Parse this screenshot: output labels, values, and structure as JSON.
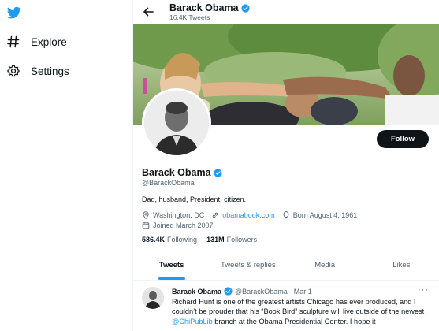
{
  "sidebar": {
    "logo": "twitter-bird-icon",
    "items": [
      {
        "label": "Explore",
        "icon": "hashtag-icon"
      },
      {
        "label": "Settings",
        "icon": "gear-icon"
      }
    ]
  },
  "header": {
    "name": "Barack Obama",
    "tweet_count": "16.4K Tweets"
  },
  "profile": {
    "name": "Barack Obama",
    "handle": "@BarackObama",
    "bio": "Dad, husband, President, citizen.",
    "location": "Washington, DC",
    "website": "obamabook.com",
    "birthday": "Born August 4, 1961",
    "joined": "Joined March 2007",
    "following_count": "586.4K",
    "following_label": "Following",
    "followers_count": "131M",
    "followers_label": "Followers",
    "follow_button": "Follow"
  },
  "tabs": [
    {
      "label": "Tweets",
      "active": true
    },
    {
      "label": "Tweets & replies",
      "active": false
    },
    {
      "label": "Media",
      "active": false
    },
    {
      "label": "Likes",
      "active": false
    }
  ],
  "tweet": {
    "name": "Barack Obama",
    "handle_date": "@BarackObama · Mar 1",
    "more": "···",
    "text_1": "Richard Hunt is one of the greatest artists Chicago has ever produced, and I couldn’t be prouder that his “Book Bird” sculpture will live outside of the newest ",
    "mention": "@ChiPubLib",
    "text_2": " branch at the Obama Presidential Center. I hope it"
  },
  "colors": {
    "accent": "#1d9bf0",
    "text": "#0f1419",
    "muted": "#536471",
    "follow_button_bg": "#0f1419"
  }
}
